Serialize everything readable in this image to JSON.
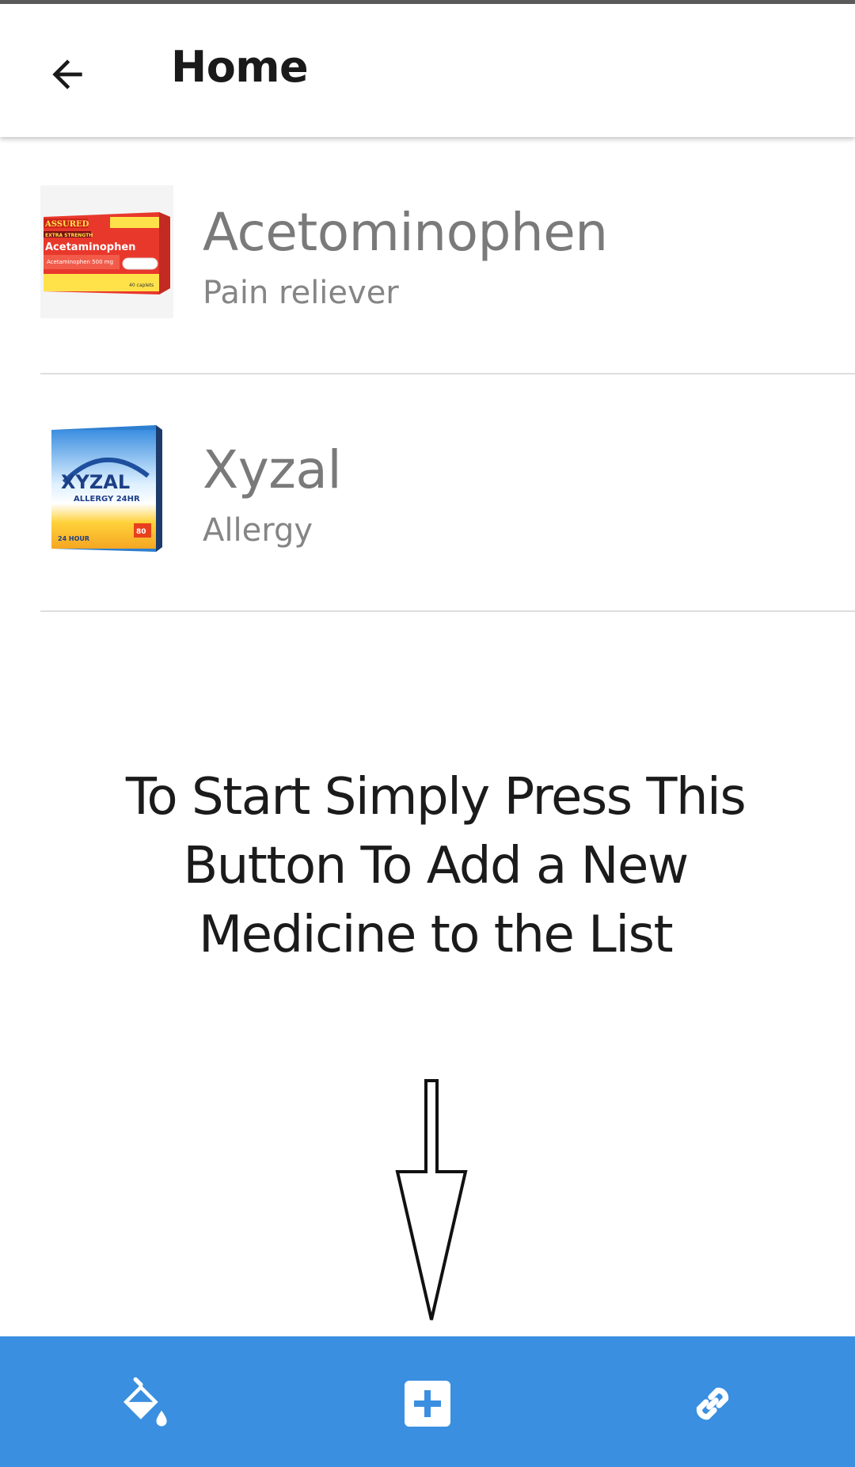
{
  "app_bar": {
    "title": "Home",
    "back_icon": "arrow-left-icon"
  },
  "medicines": [
    {
      "name": "Acetominophen",
      "category": "Pain reliever",
      "image": {
        "brand": "ASSURED",
        "badge": "EXTRA STRENGTH",
        "product": "Acetaminophen",
        "dose": "Acetaminophen 500 mg",
        "count": "40 caplets"
      }
    },
    {
      "name": "Xyzal",
      "category": "Allergy",
      "image": {
        "brand": "XYZAL",
        "line": "ALLERGY 24HR",
        "count": "80",
        "hours": "24 HOUR"
      }
    }
  ],
  "hint": {
    "text": "To Start Simply Press This Button To Add a New Medicine to the List"
  },
  "bottom_nav": {
    "items": [
      {
        "icon": "paint-bucket-icon"
      },
      {
        "icon": "plus-square-icon"
      },
      {
        "icon": "link-icon"
      }
    ]
  },
  "colors": {
    "bottom_bar": "#3a8fe0",
    "title_text": "#1a1a1a",
    "item_text": "#7a7a7a",
    "divider": "#dedede"
  }
}
